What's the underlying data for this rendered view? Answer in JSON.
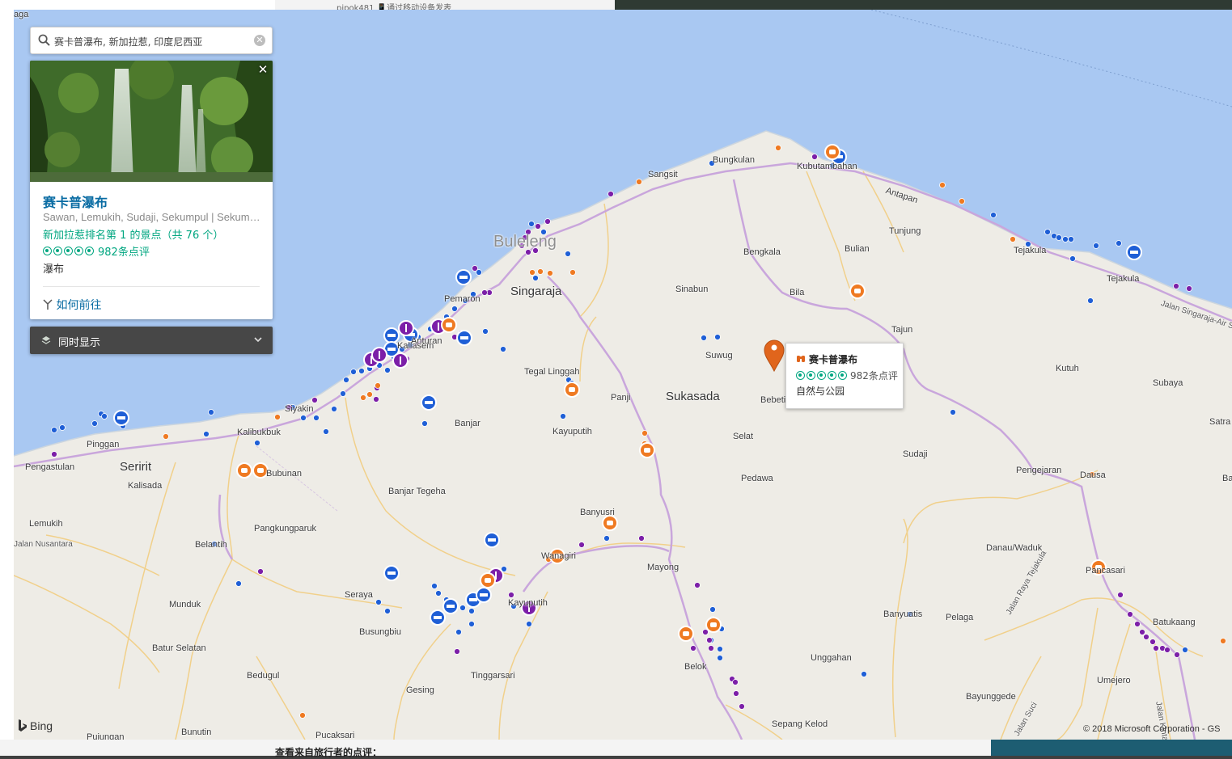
{
  "page": {
    "top_text": "pipok481  📱通过移动设备发表",
    "bottom_text": "查看来自旅行者的点评："
  },
  "search": {
    "query": "赛卡普瀑布, 新加拉惹, 印度尼西亚",
    "search_icon": "search-icon",
    "clear_icon": "clear-icon"
  },
  "card": {
    "title": "赛卡普瀑布",
    "address": "Sawan, Lemukih, Sudaji, Sekumpul | Sekumpul",
    "rank": "新加拉惹排名第 1 的景点（共 76 个）",
    "rating": 5,
    "review_count": "982条点评",
    "category": "瀑布",
    "directions_label": "如何前往",
    "close_icon": "close-icon"
  },
  "layers": {
    "label": "同时显示",
    "icon": "layers-icon",
    "chevron": "chevron-down-icon"
  },
  "popup": {
    "title": "赛卡普瀑布",
    "rating": 5,
    "review_count": "982条点评",
    "category": "自然与公园",
    "icon": "binoculars-icon"
  },
  "map": {
    "attribution_brand": "Bing",
    "copyright": "© 2018 Microsoft Corporation - GS",
    "colors": {
      "sea": "#a9c8f2",
      "land": "#eeece6",
      "major_road": "#c9a6dc",
      "minor_road": "#f4d48a",
      "hotel_marker": "#1f5fd6",
      "restaurant_marker": "#7c1fa8",
      "attraction_marker": "#ef7a22",
      "selected_pin": "#e0651c"
    },
    "place_labels": [
      {
        "text": "Buleleng",
        "size": "region"
      },
      {
        "text": "Singaraja",
        "size": "big"
      },
      {
        "text": "Sukasada",
        "size": "big"
      },
      {
        "text": "Seririt",
        "size": "big"
      },
      {
        "text": "Sangsit"
      },
      {
        "text": "Bungkulan"
      },
      {
        "text": "Kubutambahan"
      },
      {
        "text": "Tunjung"
      },
      {
        "text": "Bengkala"
      },
      {
        "text": "Bulian"
      },
      {
        "text": "Tejakula"
      },
      {
        "text": "Tejakula"
      },
      {
        "text": "Sinabun"
      },
      {
        "text": "Bila"
      },
      {
        "text": "Tajun"
      },
      {
        "text": "Pemaron"
      },
      {
        "text": "Kaliasem"
      },
      {
        "text": "Anturan"
      },
      {
        "text": "Tegal Linggah"
      },
      {
        "text": "Panji"
      },
      {
        "text": "Suwug"
      },
      {
        "text": "Bebetin"
      },
      {
        "text": "Kutuh"
      },
      {
        "text": "Subaya"
      },
      {
        "text": "Satra"
      },
      {
        "text": "Siyakin"
      },
      {
        "text": "Kalibukbuk"
      },
      {
        "text": "Banjar"
      },
      {
        "text": "Kayuputih"
      },
      {
        "text": "Selat"
      },
      {
        "text": "Sudaji"
      },
      {
        "text": "Pengejaran"
      },
      {
        "text": "Dausa"
      },
      {
        "text": "Bantang"
      },
      {
        "text": "Pinggan"
      },
      {
        "text": "Pengastulan"
      },
      {
        "text": "Kalisada"
      },
      {
        "text": "Bubunan"
      },
      {
        "text": "Banjar Tegeha"
      },
      {
        "text": "Pedawa"
      },
      {
        "text": "Lemukih"
      },
      {
        "text": "Pangkungparuk"
      },
      {
        "text": "Banyusri"
      },
      {
        "text": "Wanagiri"
      },
      {
        "text": "Danau/Waduk"
      },
      {
        "text": "Belantih"
      },
      {
        "text": "Mayong"
      },
      {
        "text": "Pancasari"
      },
      {
        "text": "Seraya"
      },
      {
        "text": "Kayuputih"
      },
      {
        "text": "Munduk"
      },
      {
        "text": "Busungbiu"
      },
      {
        "text": "Banyuatis"
      },
      {
        "text": "Pelaga"
      },
      {
        "text": "Batukaang"
      },
      {
        "text": "Batur Selatan"
      },
      {
        "text": "Unggahan"
      },
      {
        "text": "Belok"
      },
      {
        "text": "Bedugul"
      },
      {
        "text": "Tinggarsari"
      },
      {
        "text": "Gesing"
      },
      {
        "text": "Umejero"
      },
      {
        "text": "Bayunggede"
      },
      {
        "text": "Bunutin"
      },
      {
        "text": "Pucaksari"
      },
      {
        "text": "Pujungan"
      },
      {
        "text": "Sepang Kelod"
      },
      {
        "text": "Antapan"
      },
      {
        "text": "Jalan Singaraja-Air Sanih",
        "size": "road"
      },
      {
        "text": "Jalan Raya Tejakula",
        "size": "road"
      },
      {
        "text": "Jalan Suci",
        "size": "road"
      },
      {
        "text": "Jalan Kintamani",
        "size": "road"
      },
      {
        "text": "Jalan Nusantara",
        "size": "road"
      },
      {
        "text": "aga"
      }
    ]
  }
}
